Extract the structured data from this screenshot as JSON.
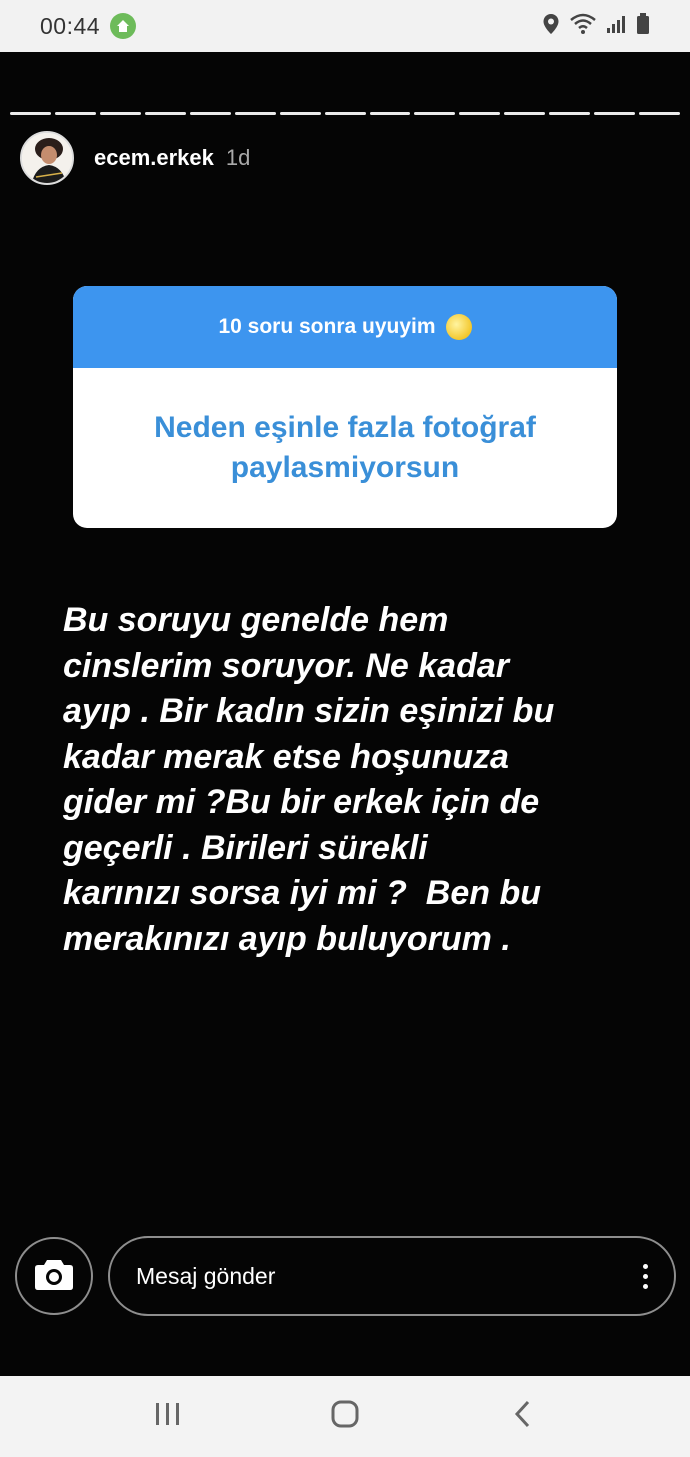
{
  "status_bar": {
    "time": "00:44",
    "icons": [
      "home-badge-icon",
      "location-icon",
      "wifi-icon",
      "signal-icon",
      "battery-icon"
    ]
  },
  "story": {
    "progress_segments": 15,
    "username": "ecem.erkek",
    "time_ago": "1d",
    "question_card": {
      "title": "10 soru sonra uyuyim",
      "title_emoji": "sleeping-moon-emoji",
      "answer": "Neden eşinle fazla fotoğraf paylasmiyorsun",
      "header_color": "#3d95ef",
      "answer_color": "#3a8fd8"
    },
    "text_lines": [
      "Bu soruyu genelde hem",
      "cinslerim soruyor. Ne kadar",
      "ayıp . Bir kadın sizin eşinizi bu",
      "kadar merak etse hoşunuza",
      "gider mi ?Bu bir erkek için de",
      "geçerli . Birileri sürekli",
      "karınızı sorsa iyi mi ?  Ben bu",
      "merakınızı ayıp buluyorum ."
    ]
  },
  "reply_bar": {
    "camera_icon": "camera-icon",
    "placeholder": "Mesaj gönder",
    "more_icon": "more-vertical-icon"
  },
  "nav_bar": {
    "buttons": [
      "recent-apps-icon",
      "home-icon",
      "back-icon"
    ]
  }
}
